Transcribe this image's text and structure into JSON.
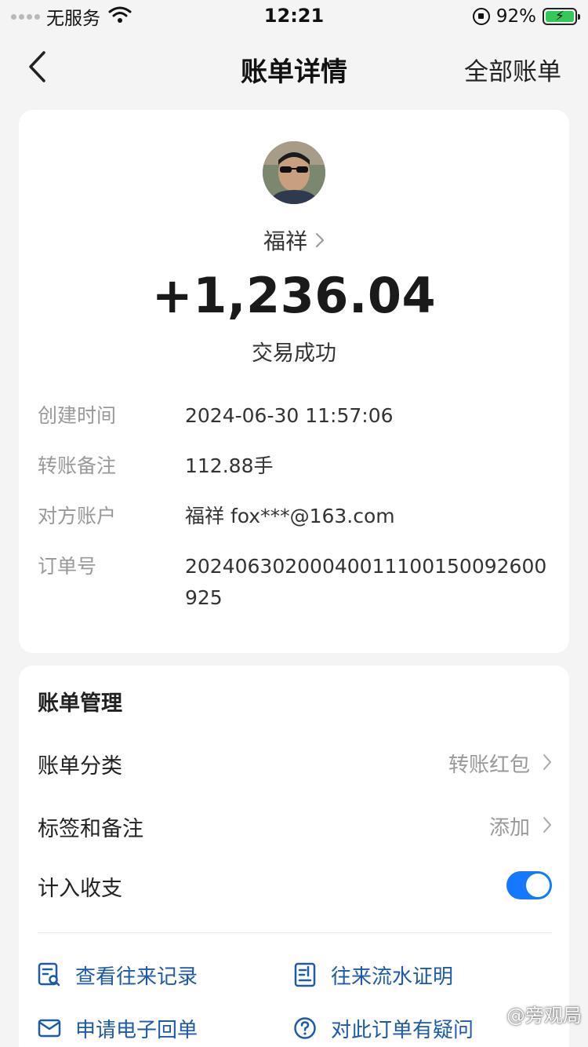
{
  "status_bar": {
    "carrier": "无服务",
    "time": "12:21",
    "battery_percent": "92%"
  },
  "nav": {
    "title": "账单详情",
    "right_link": "全部账单"
  },
  "summary": {
    "counterpart_name": "福祥",
    "amount": "+1,236.04",
    "status": "交易成功",
    "details": [
      {
        "label": "创建时间",
        "value": "2024-06-30 11:57:06"
      },
      {
        "label": "转账备注",
        "value": "112.88手"
      },
      {
        "label": "对方账户",
        "value": "福祥 fox***@163.com"
      },
      {
        "label": "订单号",
        "value": "20240630200040011100150092600925"
      }
    ]
  },
  "manage": {
    "title": "账单管理",
    "category_label": "账单分类",
    "category_value": "转账红包",
    "tags_label": "标签和备注",
    "tags_value": "添加",
    "include_label": "计入收支",
    "include_enabled": true,
    "actions": {
      "history": "查看往来记录",
      "statement": "往来流水证明",
      "receipt": "申请电子回单",
      "question": "对此订单有疑问"
    }
  },
  "watermark": "@旁观局",
  "colors": {
    "accent": "#1677ff",
    "link": "#1d5aa8",
    "battery": "#34c759",
    "background": "#f4f4f4"
  }
}
